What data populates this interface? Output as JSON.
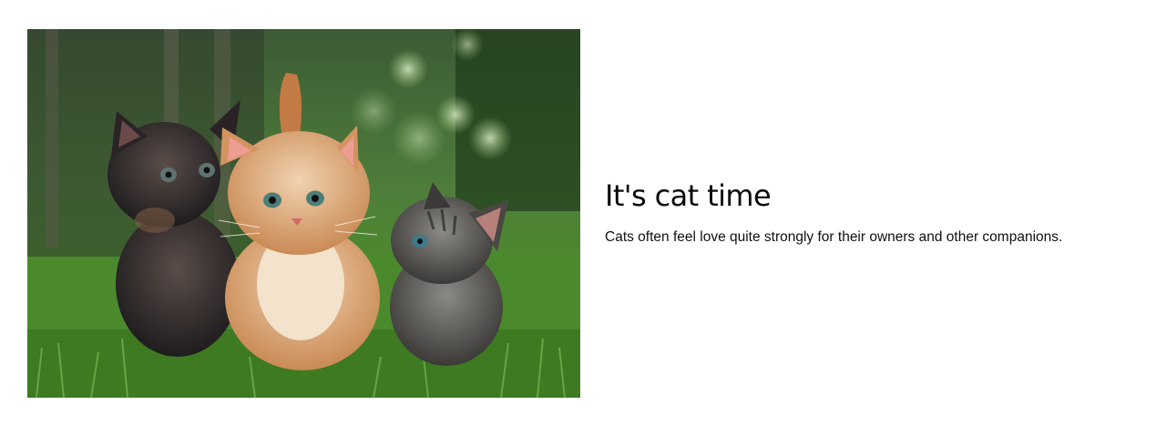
{
  "card": {
    "image_alt": "Three kittens sitting in the grass",
    "title": "It's cat time",
    "description": "Cats often feel love quite strongly for their owners and other companions."
  }
}
